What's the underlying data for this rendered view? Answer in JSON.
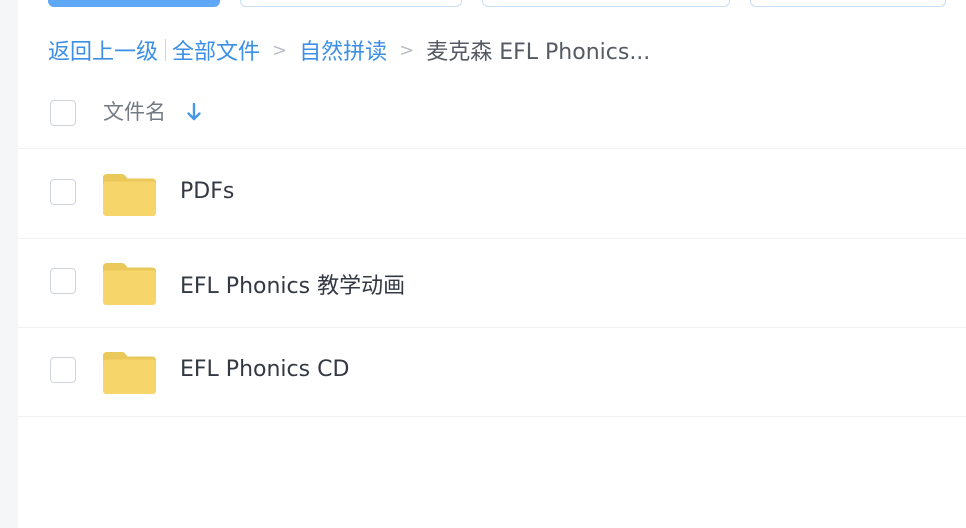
{
  "breadcrumb": {
    "back": "返回上一级",
    "all_files": "全部文件",
    "sep1": ">",
    "level1": "自然拼读",
    "sep2": ">",
    "current": "麦克森 EFL Phonics..."
  },
  "list": {
    "header": {
      "name_label": "文件名",
      "sort_icon": "arrow-down-icon"
    },
    "rows": [
      {
        "name": "PDFs",
        "icon": "folder-icon"
      },
      {
        "name": "EFL Phonics 教学动画",
        "icon": "folder-icon"
      },
      {
        "name": "EFL Phonics CD",
        "icon": "folder-icon"
      }
    ]
  },
  "colors": {
    "primary": "#5ea8f5",
    "link": "#3b8fe6",
    "folder": "#f6d56a",
    "folder_tab": "#eac85a"
  }
}
